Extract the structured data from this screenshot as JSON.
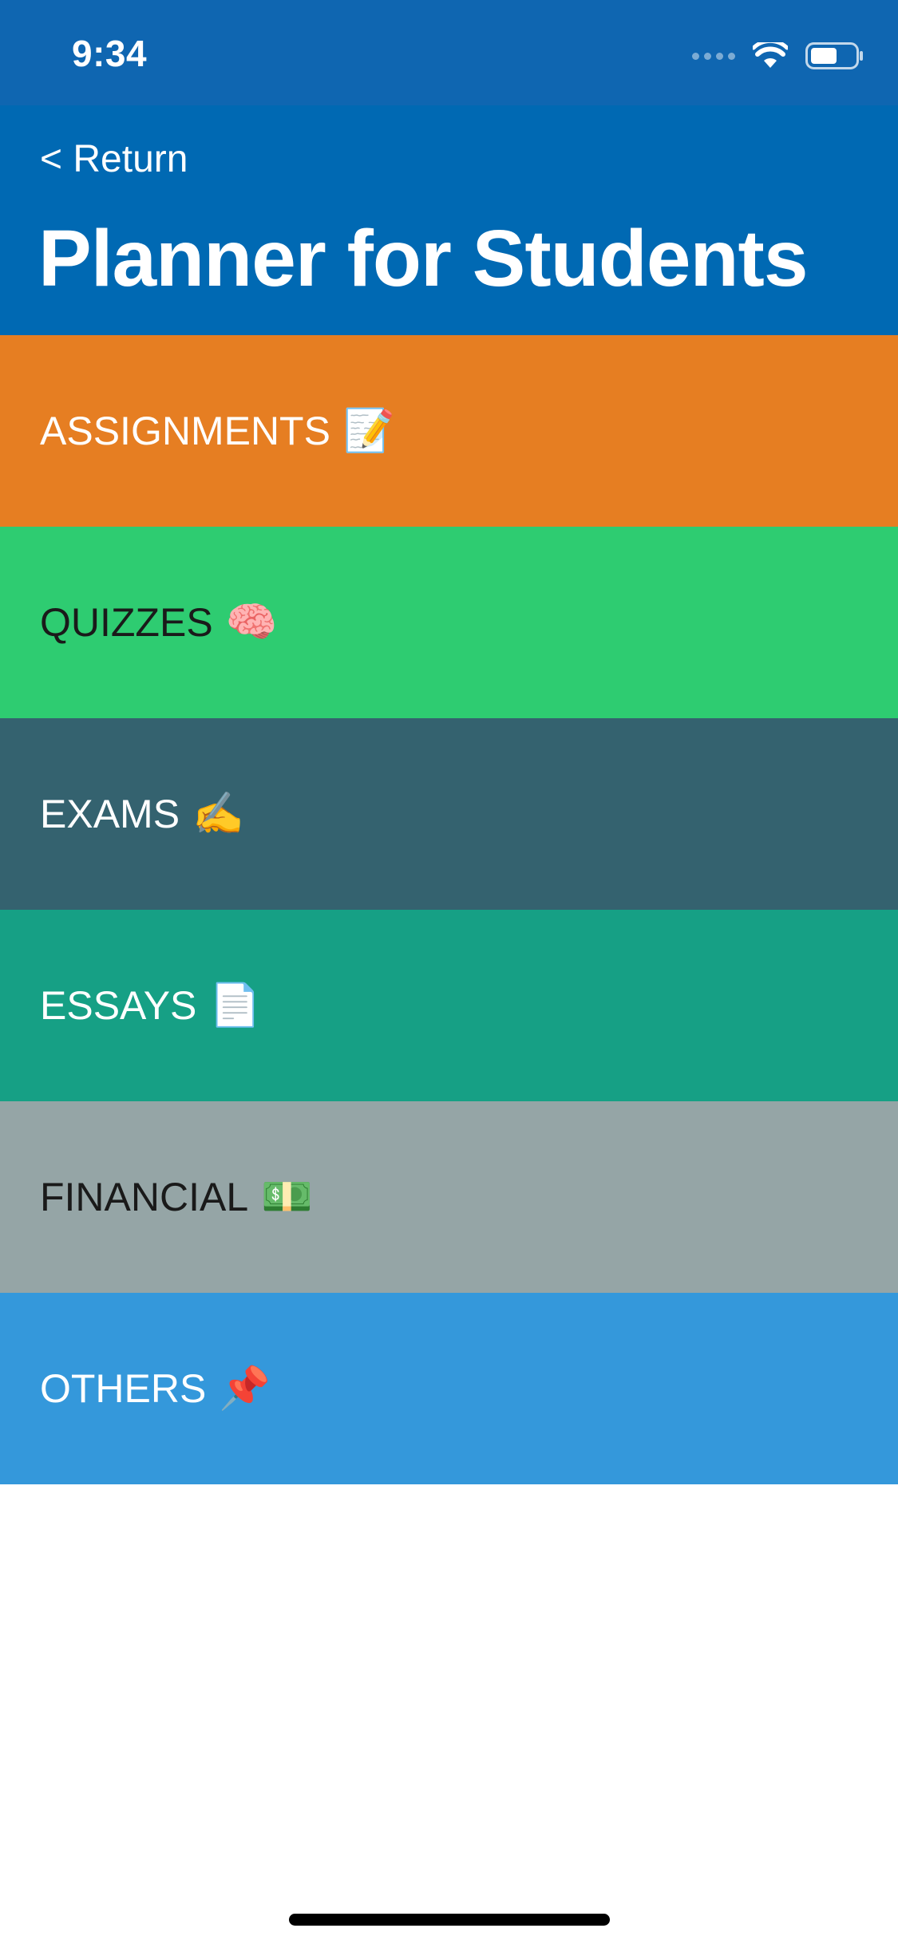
{
  "status_bar": {
    "time": "9:34",
    "background": "#0f66b1"
  },
  "nav": {
    "return_label": "< Return",
    "title": "Planner for Students",
    "background": "#0069b3"
  },
  "categories": [
    {
      "label": "ASSIGNMENTS",
      "emoji": "📝",
      "icon": "memo-icon",
      "color": "#e67e22",
      "text_color": "#ffffff"
    },
    {
      "label": "QUIZZES",
      "emoji": "🧠",
      "icon": "brain-icon",
      "color": "#2ecc71",
      "text_color": "#1a1a1a"
    },
    {
      "label": "EXAMS",
      "emoji": "✍️",
      "icon": "writing-hand-icon",
      "color": "#34626f",
      "text_color": "#ffffff"
    },
    {
      "label": "ESSAYS",
      "emoji": "📄",
      "icon": "page-icon",
      "color": "#16a085",
      "text_color": "#ffffff"
    },
    {
      "label": "FINANCIAL",
      "emoji": "💵",
      "icon": "money-icon",
      "color": "#95a5a6",
      "text_color": "#1a1a1a"
    },
    {
      "label": "OTHERS",
      "emoji": "📌",
      "icon": "pin-icon",
      "color": "#3498db",
      "text_color": "#ffffff"
    }
  ]
}
